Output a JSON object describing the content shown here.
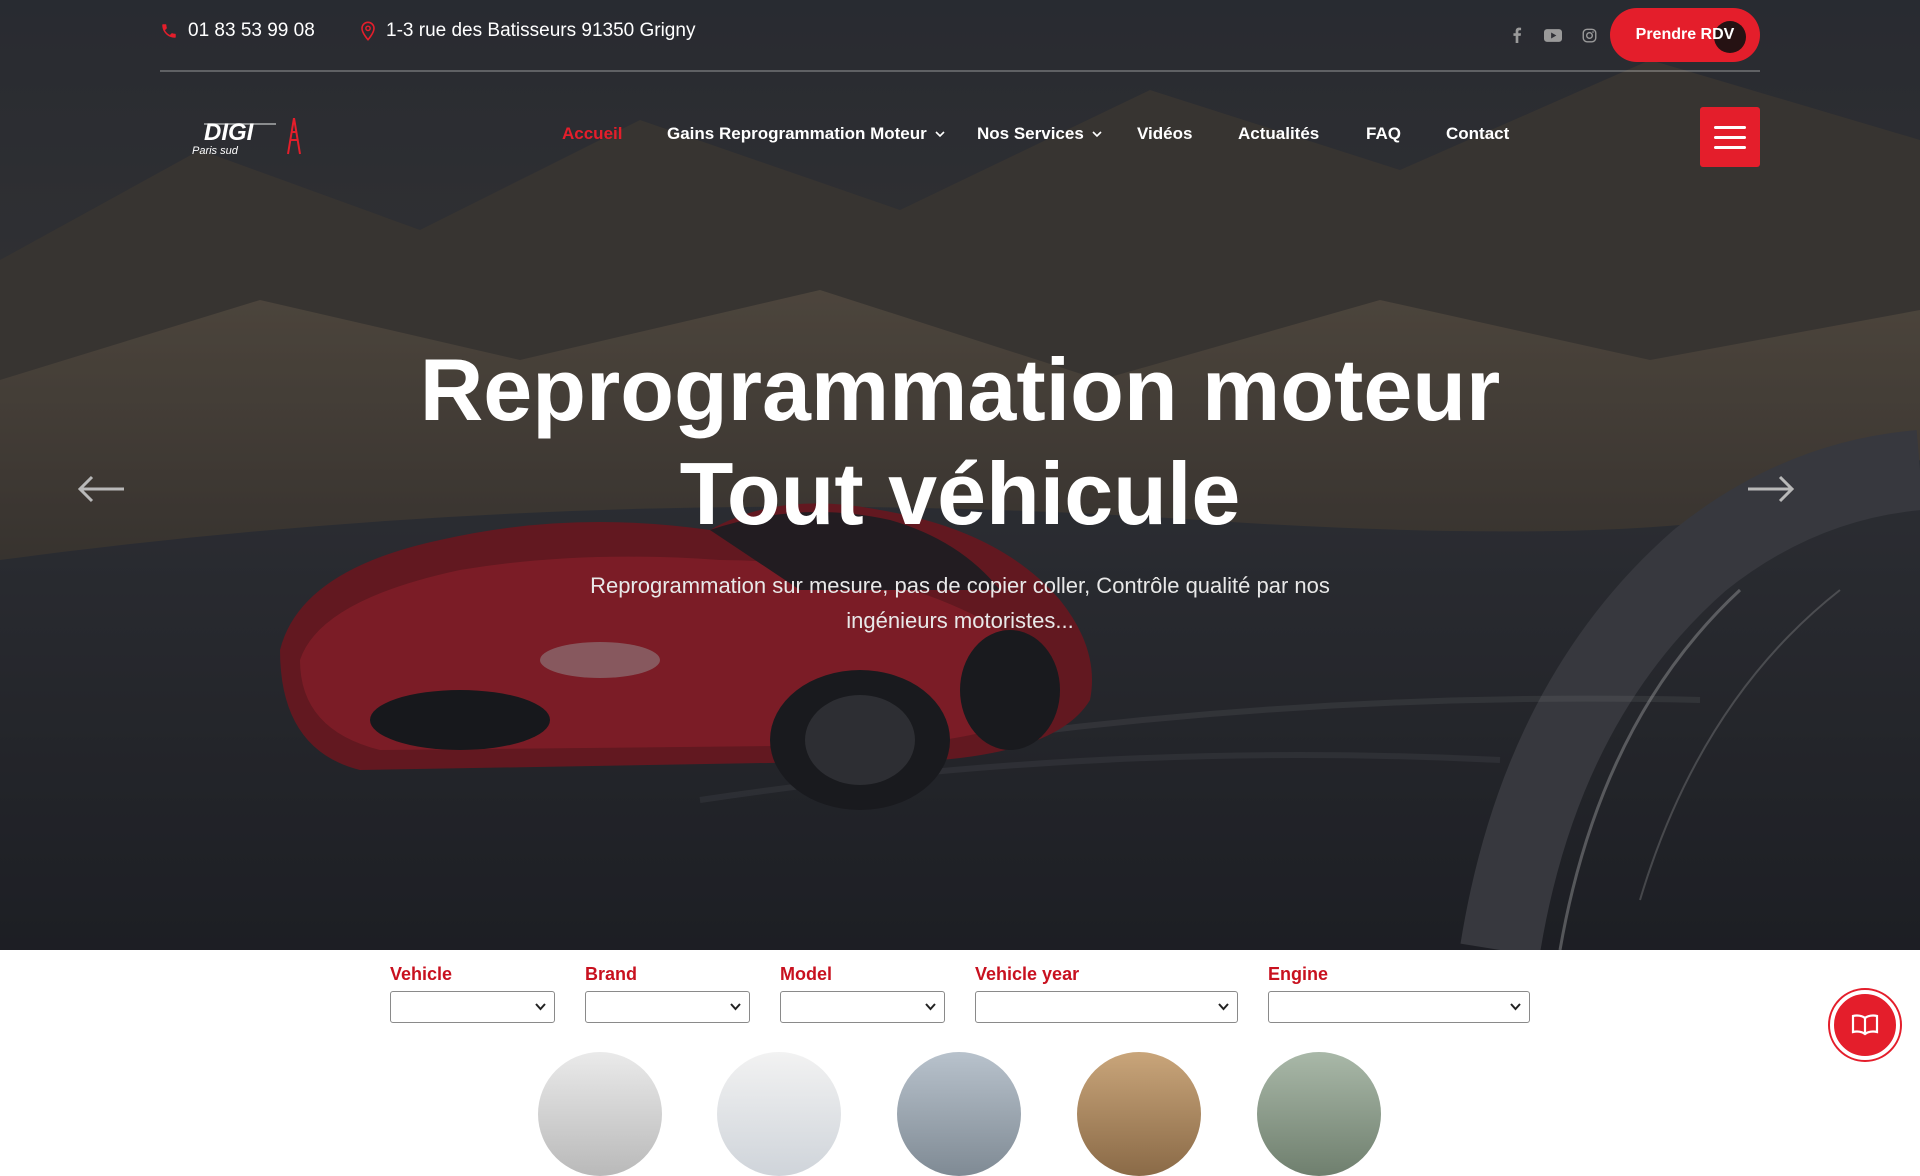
{
  "topbar": {
    "phone": "01 83 53 99 08",
    "address": "1-3 rue des Batisseurs 91350 Grigny",
    "socials": [
      "facebook-icon",
      "youtube-icon",
      "instagram-icon"
    ],
    "cta_label": "Prendre RDV"
  },
  "logo": {
    "text": "DIGI",
    "subtext": "Paris sud"
  },
  "nav": {
    "items": [
      {
        "label": "Accueil",
        "active": true,
        "dropdown": false
      },
      {
        "label": "Gains Reprogrammation Moteur",
        "active": false,
        "dropdown": true
      },
      {
        "label": "Nos Services",
        "active": false,
        "dropdown": true
      },
      {
        "label": "Vidéos",
        "active": false,
        "dropdown": false
      },
      {
        "label": "Actualités",
        "active": false,
        "dropdown": false
      },
      {
        "label": "FAQ",
        "active": false,
        "dropdown": false
      },
      {
        "label": "Contact",
        "active": false,
        "dropdown": false
      }
    ]
  },
  "hero": {
    "title_line1": "Reprogrammation moteur",
    "title_line2": "Tout véhicule",
    "subtitle": "Reprogrammation sur mesure, pas de copier coller, Contrôle qualité par nos ingénieurs motoristes..."
  },
  "selector": {
    "fields": [
      {
        "label": "Vehicle",
        "value": ""
      },
      {
        "label": "Brand",
        "value": ""
      },
      {
        "label": "Model",
        "value": ""
      },
      {
        "label": "Vehicle year",
        "value": ""
      },
      {
        "label": "Engine",
        "value": ""
      }
    ]
  },
  "colors": {
    "accent": "#e41e2b",
    "label_red": "#c8111f"
  }
}
